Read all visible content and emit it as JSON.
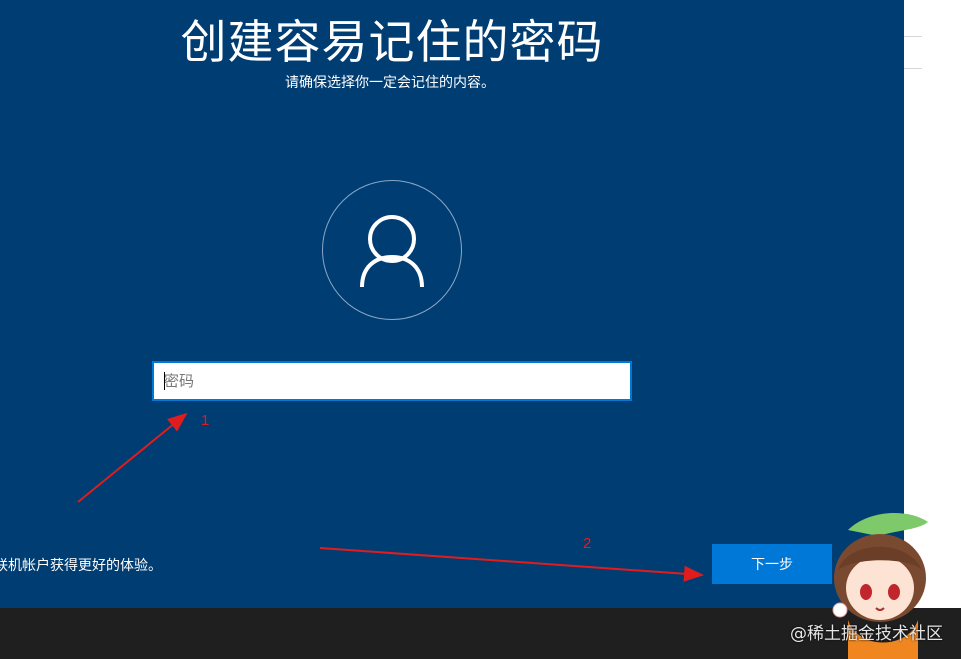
{
  "setup": {
    "title": "创建容易记住的密码",
    "subtitle": "请确保选择你一定会记住的内容。",
    "password_placeholder": "密码",
    "password_value": "",
    "footer_text": "联机帐户获得更好的体验。",
    "next_label": "下一步"
  },
  "annotations": {
    "step1": "1",
    "step2": "2"
  },
  "watermark": "@稀土掘金技术社区",
  "colors": {
    "background": "#003d73",
    "accent": "#0078d7",
    "annotation": "#e11c1c"
  },
  "icons": {
    "avatar": "user-avatar-icon"
  }
}
